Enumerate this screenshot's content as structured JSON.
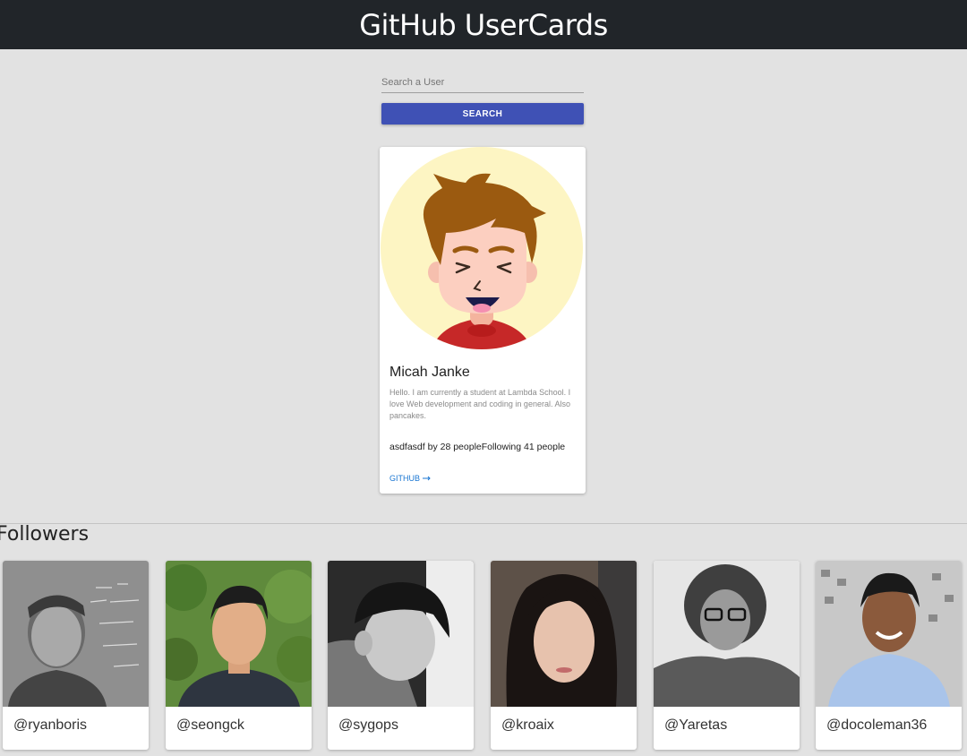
{
  "header": {
    "title": "GitHub UserCards"
  },
  "search": {
    "placeholder": "Search a User",
    "button_label": "SEARCH"
  },
  "profile": {
    "name": "Micah Janke",
    "bio": "Hello. I am currently a student at Lambda School. I love Web development and coding in general. Also pancakes.",
    "stats": "asdfasdf by 28 peopleFollowing 41 people",
    "github_link": "GITHUB",
    "avatar_icon": "cartoon-boy-avatar"
  },
  "followers": {
    "title": "Followers",
    "items": [
      {
        "handle": "@ryanboris"
      },
      {
        "handle": "@seongck"
      },
      {
        "handle": "@sygops"
      },
      {
        "handle": "@kroaix"
      },
      {
        "handle": "@Yaretas"
      },
      {
        "handle": "@docoleman36"
      }
    ]
  },
  "colors": {
    "header_bg": "#212529",
    "page_bg": "#e2e2e2",
    "primary_button": "#3f51b5",
    "link": "#1976d2"
  }
}
